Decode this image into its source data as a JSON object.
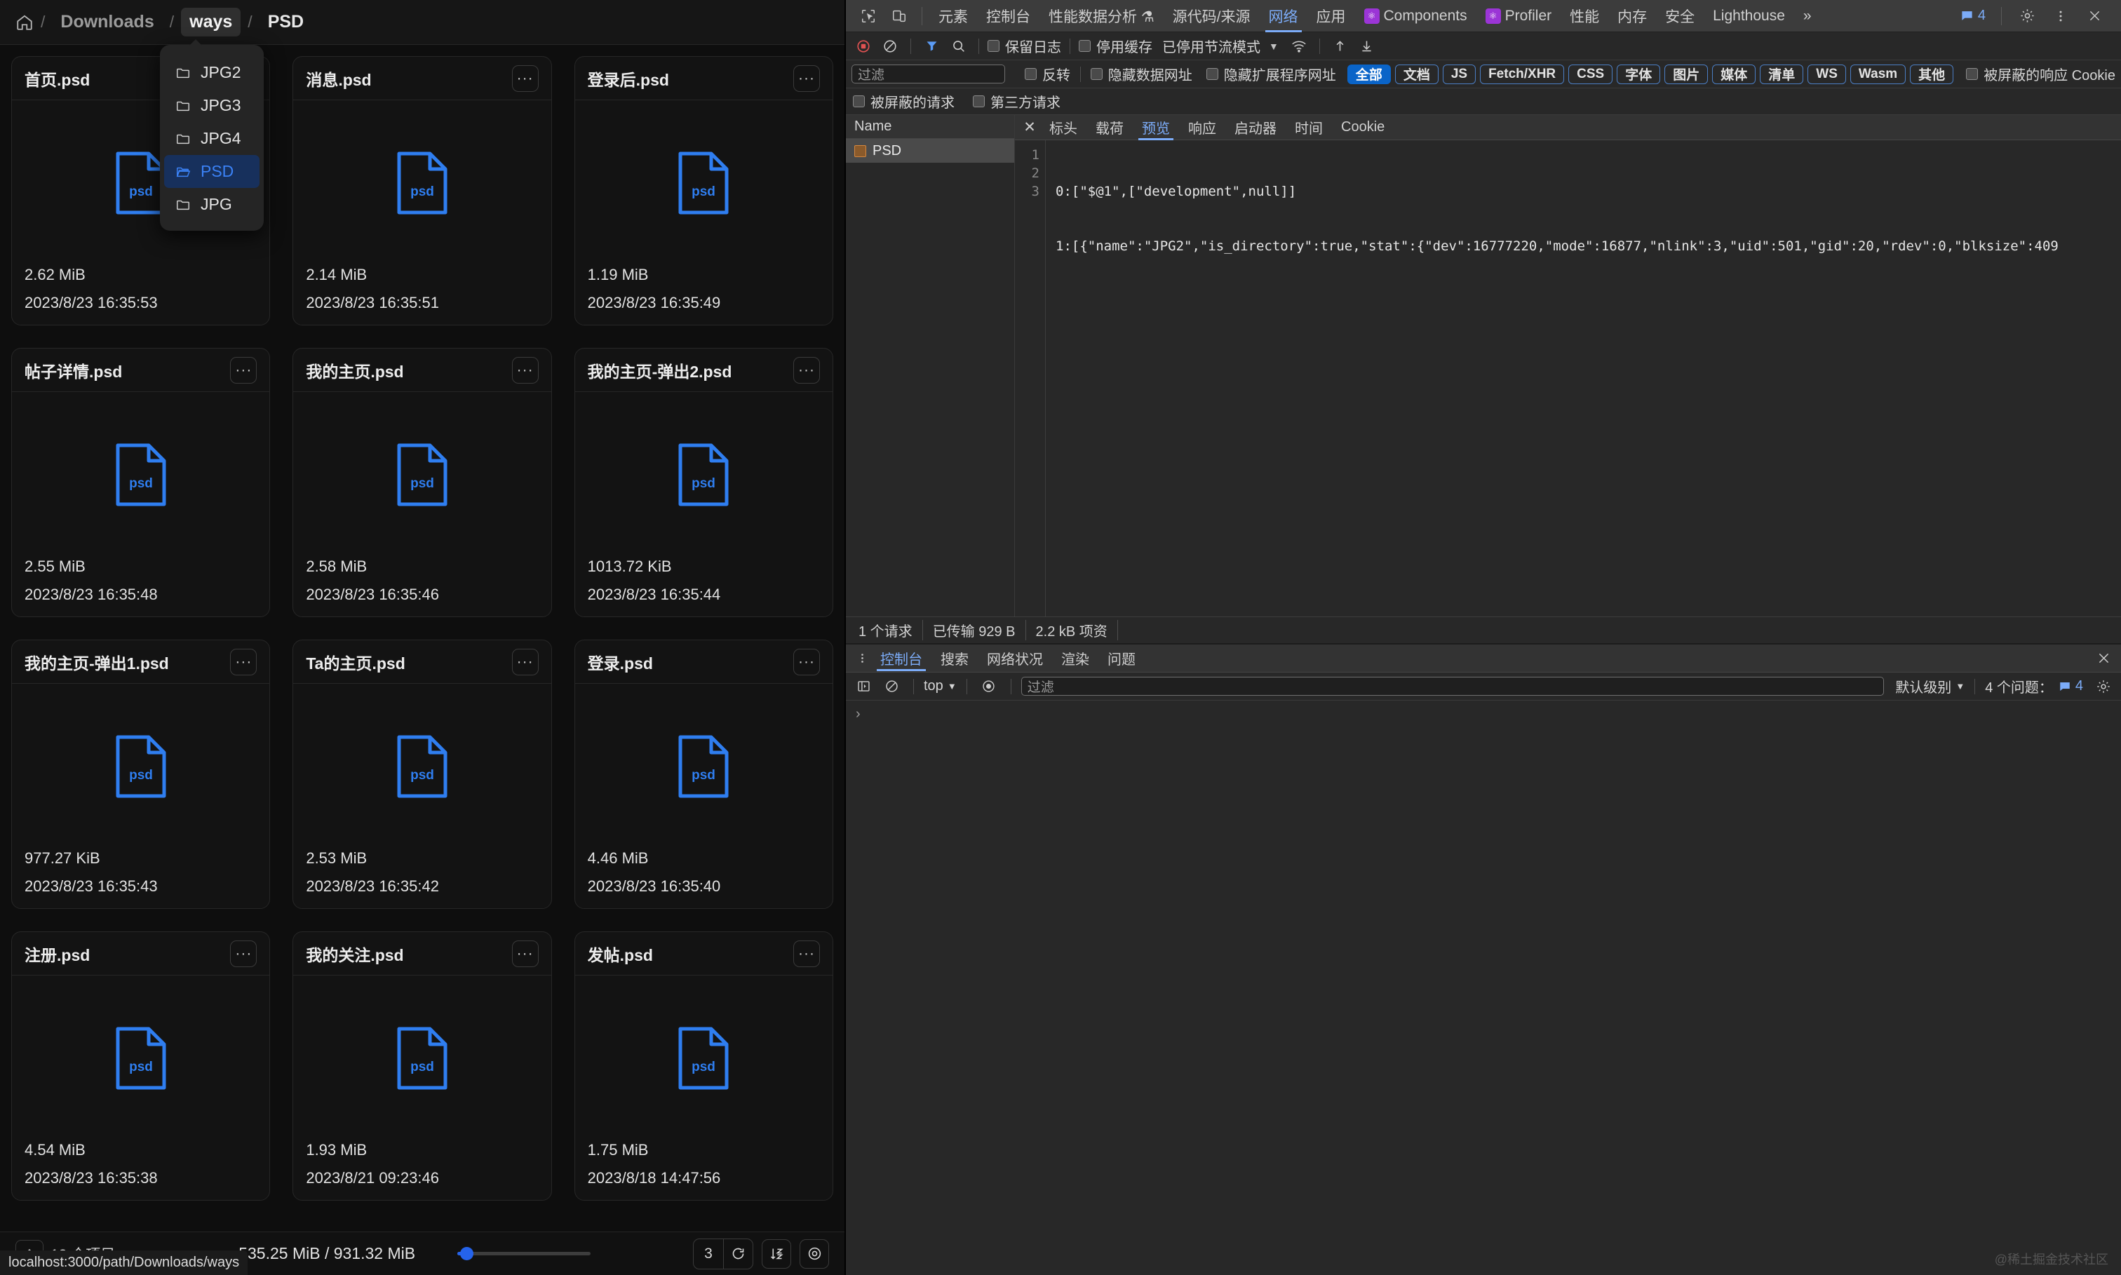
{
  "file_manager": {
    "breadcrumb": {
      "home_icon": "home-icon",
      "items": [
        {
          "label": "Downloads",
          "state": "normal"
        },
        {
          "label": "ways",
          "state": "active"
        },
        {
          "label": "PSD",
          "state": "current"
        }
      ],
      "separator": "/"
    },
    "dropdown": {
      "items": [
        {
          "label": "JPG2",
          "selected": false
        },
        {
          "label": "JPG3",
          "selected": false
        },
        {
          "label": "JPG4",
          "selected": false
        },
        {
          "label": "PSD",
          "selected": true
        },
        {
          "label": "JPG",
          "selected": false
        }
      ]
    },
    "files": [
      {
        "name": "首页.psd",
        "size": "2.62 MiB",
        "date": "2023/8/23 16:35:53",
        "icon": "psd-file-icon",
        "menu": "···"
      },
      {
        "name": "消息.psd",
        "size": "2.14 MiB",
        "date": "2023/8/23 16:35:51",
        "icon": "psd-file-icon",
        "menu": "···"
      },
      {
        "name": "登录后.psd",
        "size": "1.19 MiB",
        "date": "2023/8/23 16:35:49",
        "icon": "psd-file-icon",
        "menu": "···"
      },
      {
        "name": "帖子详情.psd",
        "size": "2.55 MiB",
        "date": "2023/8/23 16:35:48",
        "icon": "psd-file-icon",
        "menu": "···"
      },
      {
        "name": "我的主页.psd",
        "size": "2.58 MiB",
        "date": "2023/8/23 16:35:46",
        "icon": "psd-file-icon",
        "menu": "···"
      },
      {
        "name": "我的主页-弹出2.psd",
        "size": "1013.72 KiB",
        "date": "2023/8/23 16:35:44",
        "icon": "psd-file-icon",
        "menu": "···"
      },
      {
        "name": "我的主页-弹出1.psd",
        "size": "977.27 KiB",
        "date": "2023/8/23 16:35:43",
        "icon": "psd-file-icon",
        "menu": "···"
      },
      {
        "name": "Ta的主页.psd",
        "size": "2.53 MiB",
        "date": "2023/8/23 16:35:42",
        "icon": "psd-file-icon",
        "menu": "···"
      },
      {
        "name": "登录.psd",
        "size": "4.46 MiB",
        "date": "2023/8/23 16:35:40",
        "icon": "psd-file-icon",
        "menu": "···"
      },
      {
        "name": "注册.psd",
        "size": "4.54 MiB",
        "date": "2023/8/23 16:35:38",
        "icon": "psd-file-icon",
        "menu": "···"
      },
      {
        "name": "我的关注.psd",
        "size": "1.93 MiB",
        "date": "2023/8/21 09:23:46",
        "icon": "psd-file-icon",
        "menu": "···"
      },
      {
        "name": "发帖.psd",
        "size": "1.75 MiB",
        "date": "2023/8/18 14:47:56",
        "icon": "psd-file-icon",
        "menu": "···"
      }
    ],
    "file_icon_label": "psd",
    "status_bar": {
      "up_icon": "arrow-up-icon",
      "item_count": "12 个项目",
      "disk_usage": "535.25 MiB  /  931.32 MiB",
      "zoom_value": "3",
      "refresh_icon": "refresh-icon",
      "sort_icon": "sort-az-icon",
      "view_icon": "eye-icon",
      "url_tooltip": "localhost:3000/path/Downloads/ways"
    }
  },
  "devtools": {
    "tabbar": {
      "inspect_icon": "inspect-element-icon",
      "device_icon": "device-toolbar-icon",
      "tabs": [
        {
          "label": "元素",
          "selected": false,
          "badge": null
        },
        {
          "label": "控制台",
          "selected": false,
          "badge": null
        },
        {
          "label": "性能数据分析 ⚗",
          "selected": false,
          "badge": null
        },
        {
          "label": "源代码/来源",
          "selected": false,
          "badge": null
        },
        {
          "label": "网络",
          "selected": true,
          "badge": null
        },
        {
          "label": "应用",
          "selected": false,
          "badge": null
        },
        {
          "label": "Components",
          "selected": false,
          "badge": "react"
        },
        {
          "label": "Profiler",
          "selected": false,
          "badge": "react"
        },
        {
          "label": "性能",
          "selected": false,
          "badge": null
        },
        {
          "label": "内存",
          "selected": false,
          "badge": null
        },
        {
          "label": "安全",
          "selected": false,
          "badge": null
        },
        {
          "label": "Lighthouse",
          "selected": false,
          "badge": null
        }
      ],
      "overflow": "»",
      "message_count": "4",
      "settings_icon": "gear-icon",
      "more_icon": "kebab-menu-icon",
      "close_icon": "close-icon"
    },
    "network_toolbar": {
      "record_icon": "record-stop-icon",
      "clear_icon": "clear-icon",
      "filter_icon": "filter-funnel-icon",
      "search_icon": "search-icon",
      "preserve_log": "保留日志",
      "disable_cache": "停用缓存",
      "throttling": "已停用节流模式",
      "wifi_icon": "network-conditions-icon",
      "import_icon": "import-har-icon",
      "export_icon": "export-har-icon"
    },
    "filters": {
      "input_placeholder": "过滤",
      "invert": "反转",
      "hide_data_urls": "隐藏数据网址",
      "hide_ext_urls": "隐藏扩展程序网址",
      "types": [
        {
          "label": "全部",
          "active": true
        },
        {
          "label": "文档",
          "active": false
        },
        {
          "label": "JS",
          "active": false
        },
        {
          "label": "Fetch/XHR",
          "active": false
        },
        {
          "label": "CSS",
          "active": false
        },
        {
          "label": "字体",
          "active": false
        },
        {
          "label": "图片",
          "active": false
        },
        {
          "label": "媒体",
          "active": false
        },
        {
          "label": "清单",
          "active": false
        },
        {
          "label": "WS",
          "active": false
        },
        {
          "label": "Wasm",
          "active": false
        },
        {
          "label": "其他",
          "active": false
        }
      ],
      "blocked_cookies": "被屏蔽的响应 Cookie",
      "blocked_requests": "被屏蔽的请求",
      "third_party": "第三方请求"
    },
    "request_list": {
      "column_header": "Name",
      "rows": [
        {
          "name": "PSD",
          "selected": true,
          "icon": "document-icon"
        }
      ]
    },
    "detail_tabs": {
      "close_label": "✕",
      "tabs": [
        {
          "label": "标头",
          "selected": false
        },
        {
          "label": "载荷",
          "selected": false
        },
        {
          "label": "预览",
          "selected": true
        },
        {
          "label": "响应",
          "selected": false
        },
        {
          "label": "启动器",
          "selected": false
        },
        {
          "label": "时间",
          "selected": false
        },
        {
          "label": "Cookie",
          "selected": false
        }
      ]
    },
    "preview": {
      "line_numbers": [
        "1",
        "2",
        "3"
      ],
      "lines": [
        "0:[\"$@1\",[\"development\",null]]",
        "1:[{\"name\":\"JPG2\",\"is_directory\":true,\"stat\":{\"dev\":16777220,\"mode\":16877,\"nlink\":3,\"uid\":501,\"gid\":20,\"rdev\":0,\"blksize\":409",
        ""
      ]
    },
    "network_status": {
      "requests": "1 个请求",
      "transferred": "已传输 929 B",
      "resources": "2.2 kB 项资"
    },
    "console": {
      "kebab_icon": "kebab-menu-icon",
      "tabs": [
        {
          "label": "控制台",
          "selected": true
        },
        {
          "label": "搜索",
          "selected": false
        },
        {
          "label": "网络状况",
          "selected": false
        },
        {
          "label": "渲染",
          "selected": false
        },
        {
          "label": "问题",
          "selected": false
        }
      ],
      "close_icon": "close-icon",
      "sidebar_icon": "console-sidebar-icon",
      "clear_icon": "clear-console-icon",
      "context": "top",
      "eye_icon": "live-expression-icon",
      "filter_placeholder": "过滤",
      "level": "默认级别",
      "issues_label": "4 个问题：",
      "issues_count": "4",
      "settings_icon": "gear-icon",
      "prompt": "›"
    },
    "watermark": "@稀土掘金技术社区"
  }
}
